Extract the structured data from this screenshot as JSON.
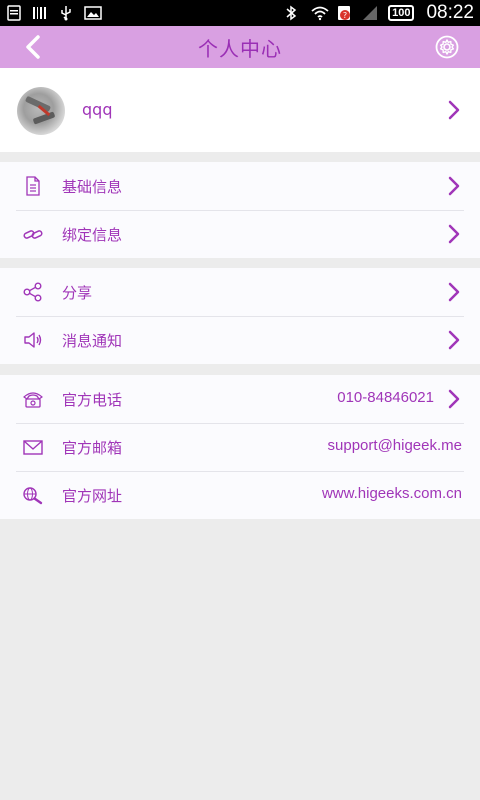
{
  "status_bar": {
    "battery": "100",
    "time": "08:22"
  },
  "header": {
    "title": "个人中心",
    "back_icon": "chevron-left-icon",
    "settings_icon": "gear-icon"
  },
  "profile": {
    "username": "qqq"
  },
  "groups": {
    "account": [
      {
        "label": "基础信息",
        "icon": "document-icon"
      },
      {
        "label": "绑定信息",
        "icon": "link-icon"
      }
    ],
    "social": [
      {
        "label": "分享",
        "icon": "share-icon"
      },
      {
        "label": "消息通知",
        "icon": "speaker-icon"
      }
    ],
    "contact": [
      {
        "label": "官方电话",
        "value": "010-84846021",
        "icon": "phone-icon"
      },
      {
        "label": "官方邮箱",
        "value": "support@higeek.me",
        "icon": "mail-icon"
      },
      {
        "label": "官方网址",
        "value": "www.higeeks.com.cn",
        "icon": "web-search-icon"
      }
    ]
  },
  "colors": {
    "accent": "#a035b8",
    "header_bg": "#d9a0e2",
    "page_bg": "#ececec",
    "row_bg": "#fbfbfe"
  }
}
